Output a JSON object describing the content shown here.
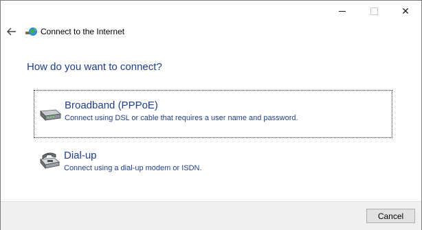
{
  "window": {
    "title": "Connect to the Internet",
    "minimize_icon": "minimize-icon",
    "maximize_icon": "maximize-icon",
    "close_glyph": "✕"
  },
  "nav": {
    "back_icon": "back-arrow-icon"
  },
  "heading": "How do you want to connect?",
  "options": [
    {
      "icon": "broadband-modem-icon",
      "title": "Broadband (PPPoE)",
      "description": "Connect using DSL or cable that requires a user name and password.",
      "selected": true
    },
    {
      "icon": "dialup-phone-icon",
      "title": "Dial-up",
      "description": "Connect using a dial-up modem or ISDN.",
      "selected": false
    }
  ],
  "footer": {
    "cancel_label": "Cancel"
  },
  "colors": {
    "link_blue": "#1e3e8a",
    "footer_bg": "#f0f0f0"
  }
}
